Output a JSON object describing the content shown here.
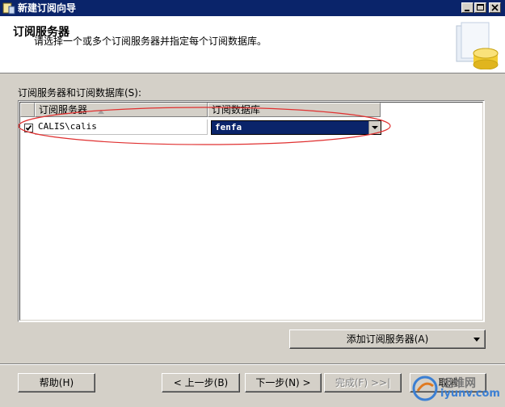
{
  "window": {
    "title": "新建订阅向导",
    "controls": [
      "minimize",
      "maximize",
      "close"
    ]
  },
  "header": {
    "title": "订阅服务器",
    "subtitle": "请选择一个或多个订阅服务器并指定每个订阅数据库。",
    "graphic": "database-wizard-icon"
  },
  "grid": {
    "label": "订阅服务器和订阅数据库(S):",
    "columns": [
      "订阅服务器",
      "订阅数据库"
    ],
    "rows": [
      {
        "checked": true,
        "subscriber": "CALIS\\calis",
        "database": "fenfa"
      }
    ]
  },
  "add_button": {
    "label": "添加订阅服务器(A)"
  },
  "footer": {
    "help": "帮助(H)",
    "back": "< 上一步(B)",
    "next": "下一步(N) >",
    "finish": "完成(F) >>|",
    "cancel": "取消"
  },
  "watermark": {
    "cn": "运维网",
    "en": "iyunv.com"
  }
}
